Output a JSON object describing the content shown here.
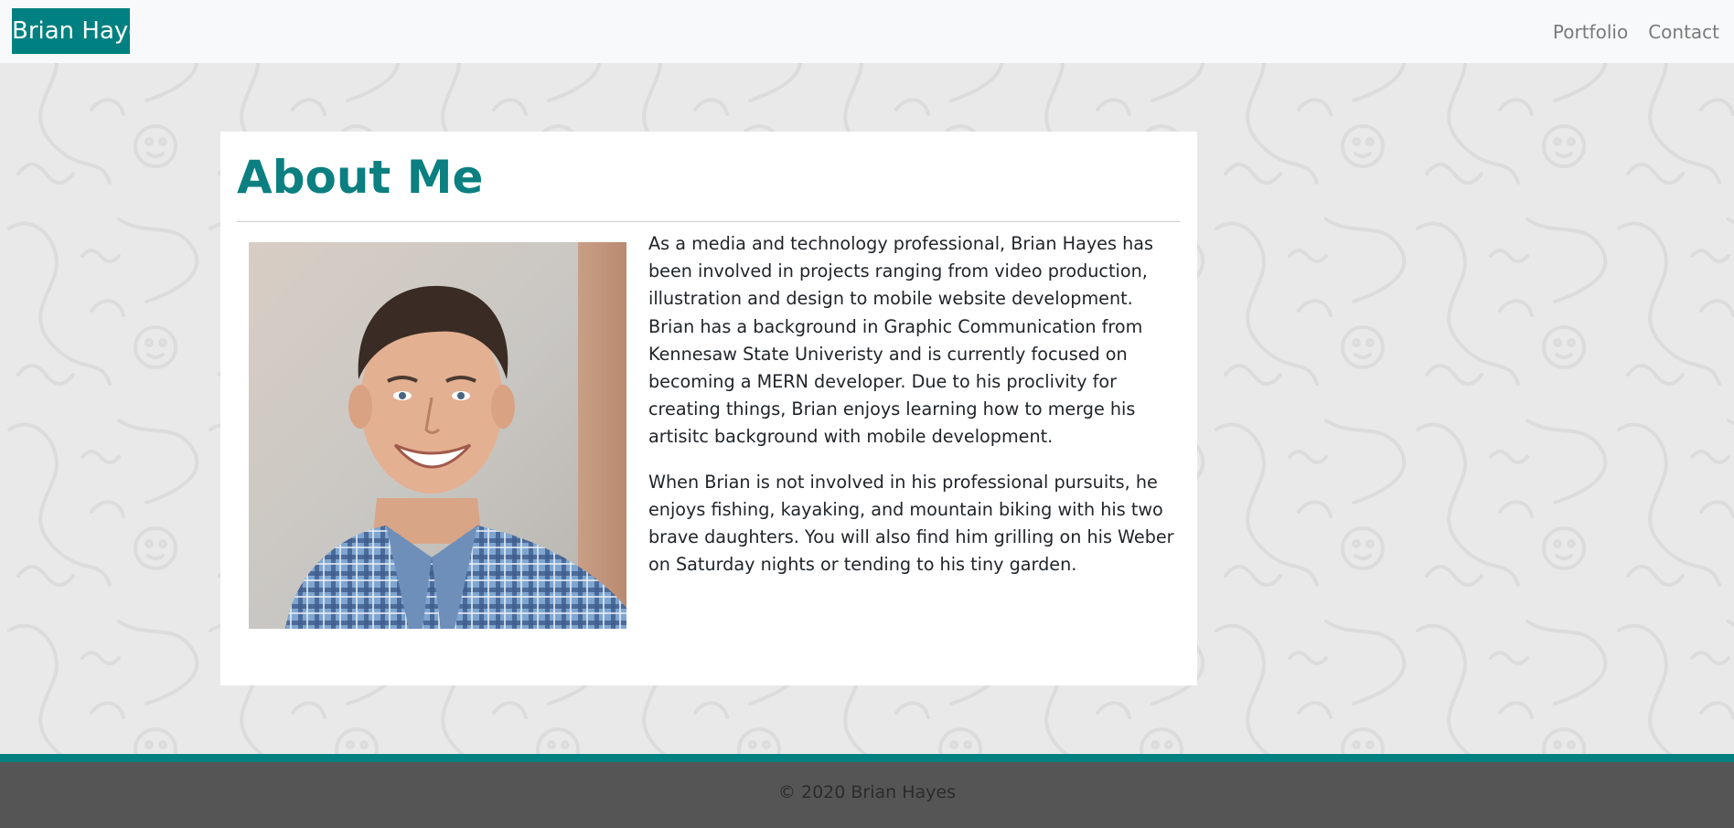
{
  "navbar": {
    "brand": "Brian Hayes",
    "links": [
      {
        "label": "Portfolio"
      },
      {
        "label": "Contact"
      }
    ]
  },
  "about": {
    "title": "About Me",
    "photo_icon": "portrait-photo",
    "paragraphs": [
      "As a media and technology professional, Brian Hayes has been involved in projects ranging from video production, illustration and design to mobile website development. Brian has a background in Graphic Communication from Kennesaw State Univeristy and is currently focused on becoming a MERN developer. Due to his proclivity for creating things, Brian enjoys learning how to merge his artisitc background with mobile development.",
      "When Brian is not involved in his professional pursuits, he enjoys fishing, kayaking, and mountain biking with his two brave daughters. You will also find him grilling on his Weber on Saturday nights or tending to his tiny garden."
    ]
  },
  "footer": {
    "copyright": "© 2020 Brian Hayes"
  },
  "colors": {
    "accent": "#008080",
    "title": "#0c7f80",
    "navbar_bg": "#f8f9fa",
    "page_bg": "#e9e9e9",
    "footer_bg": "#555555"
  }
}
